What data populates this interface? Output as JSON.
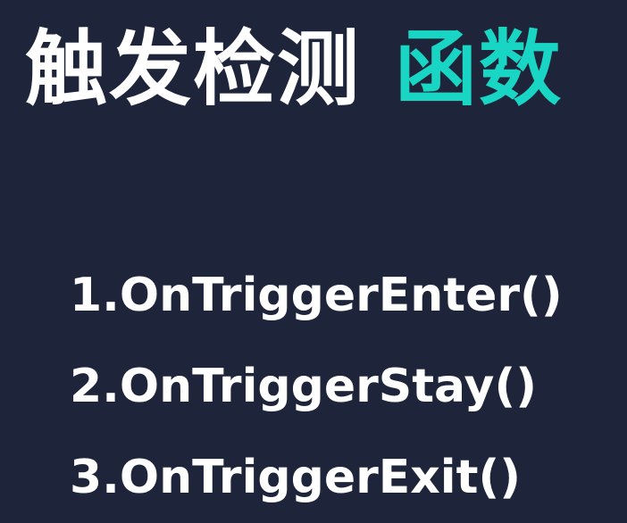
{
  "title": {
    "main": "触发检测",
    "accent": "函数"
  },
  "functions": [
    "1.OnTriggerEnter()",
    "2.OnTriggerStay()",
    "3.OnTriggerExit()"
  ],
  "colors": {
    "background": "#1e253a",
    "text": "#ffffff",
    "accent": "#19d6c4"
  }
}
